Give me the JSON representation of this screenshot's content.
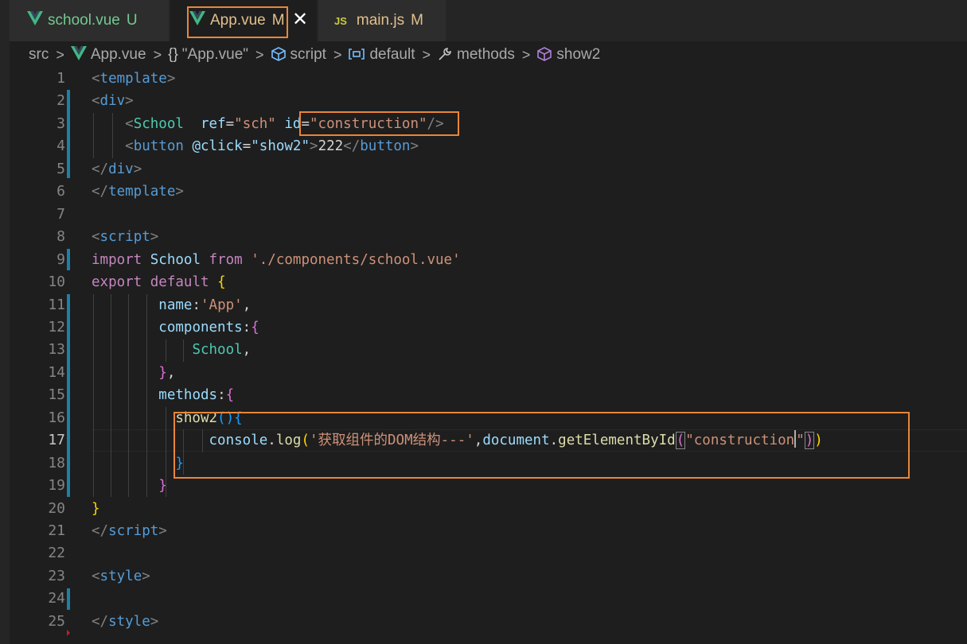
{
  "tabs": [
    {
      "label": "school.vue",
      "status": "U",
      "icon": "vue-icon",
      "label_color": "#73c991",
      "status_color": "#73c991"
    },
    {
      "label": "App.vue",
      "status": "M",
      "icon": "vue-icon",
      "label_color": "#e2c08d",
      "status_color": "#e2c08d",
      "active": true,
      "close": "✕"
    },
    {
      "label": "main.js",
      "status": "M",
      "icon": "js-icon",
      "icon_text": "JS",
      "label_color": "#e2c08d",
      "status_color": "#e2c08d"
    }
  ],
  "breadcrumb": {
    "items": [
      {
        "label": "src",
        "icon": ""
      },
      {
        "label": "App.vue",
        "icon": "vue-icon"
      },
      {
        "label": "\"App.vue\"",
        "icon": "braces-icon",
        "icon_text": "{}"
      },
      {
        "label": "script",
        "icon": "cube-icon"
      },
      {
        "label": "default",
        "icon": "variable-icon"
      },
      {
        "label": "methods",
        "icon": "wrench-icon"
      },
      {
        "label": "show2",
        "icon": "cube-icon"
      }
    ]
  },
  "editor": {
    "current_line": 17,
    "line_numbers": [
      "1",
      "2",
      "3",
      "4",
      "5",
      "6",
      "7",
      "8",
      "9",
      "10",
      "11",
      "12",
      "13",
      "14",
      "15",
      "16",
      "17",
      "18",
      "19",
      "20",
      "21",
      "22",
      "23",
      "24",
      "25"
    ],
    "lines": [
      [
        {
          "t": "<",
          "c": "c-punc"
        },
        {
          "t": "template",
          "c": "c-tag"
        },
        {
          "t": ">",
          "c": "c-punc"
        }
      ],
      [
        {
          "t": "<",
          "c": "c-punc"
        },
        {
          "t": "div",
          "c": "c-tag"
        },
        {
          "t": ">",
          "c": "c-punc"
        }
      ],
      [
        {
          "t": "    ",
          "c": "c-plain"
        },
        {
          "t": "<",
          "c": "c-punc"
        },
        {
          "t": "School",
          "c": "c-cls"
        },
        {
          "t": "  ",
          "c": "c-plain"
        },
        {
          "t": "ref",
          "c": "c-attr"
        },
        {
          "t": "=",
          "c": "c-plain"
        },
        {
          "t": "\"sch\"",
          "c": "c-str"
        },
        {
          "t": " ",
          "c": "c-plain"
        },
        {
          "t": "id",
          "c": "c-attr"
        },
        {
          "t": "=",
          "c": "c-plain"
        },
        {
          "t": "\"construction\"",
          "c": "c-str"
        },
        {
          "t": "/>",
          "c": "c-punc"
        }
      ],
      [
        {
          "t": "    ",
          "c": "c-plain"
        },
        {
          "t": "<",
          "c": "c-punc"
        },
        {
          "t": "button",
          "c": "c-tag"
        },
        {
          "t": " ",
          "c": "c-plain"
        },
        {
          "t": "@click",
          "c": "c-attr"
        },
        {
          "t": "=",
          "c": "c-plain"
        },
        {
          "t": "\"",
          "c": "c-attr"
        },
        {
          "t": "show2",
          "c": "c-var"
        },
        {
          "t": "\"",
          "c": "c-attr"
        },
        {
          "t": ">",
          "c": "c-punc"
        },
        {
          "t": "222",
          "c": "c-plain"
        },
        {
          "t": "</",
          "c": "c-punc"
        },
        {
          "t": "button",
          "c": "c-tag"
        },
        {
          "t": ">",
          "c": "c-punc"
        }
      ],
      [
        {
          "t": "</",
          "c": "c-punc"
        },
        {
          "t": "div",
          "c": "c-tag"
        },
        {
          "t": ">",
          "c": "c-punc"
        }
      ],
      [
        {
          "t": "</",
          "c": "c-punc"
        },
        {
          "t": "template",
          "c": "c-tag"
        },
        {
          "t": ">",
          "c": "c-punc"
        }
      ],
      [],
      [
        {
          "t": "<",
          "c": "c-punc"
        },
        {
          "t": "script",
          "c": "c-tag"
        },
        {
          "t": ">",
          "c": "c-punc"
        }
      ],
      [
        {
          "t": "import",
          "c": "c-kw"
        },
        {
          "t": " ",
          "c": "c-plain"
        },
        {
          "t": "School",
          "c": "c-var"
        },
        {
          "t": " ",
          "c": "c-plain"
        },
        {
          "t": "from",
          "c": "c-kw"
        },
        {
          "t": " ",
          "c": "c-plain"
        },
        {
          "t": "'./components/school.vue'",
          "c": "c-str"
        }
      ],
      [
        {
          "t": "export",
          "c": "c-kw"
        },
        {
          "t": " ",
          "c": "c-plain"
        },
        {
          "t": "default",
          "c": "c-kw"
        },
        {
          "t": " ",
          "c": "c-plain"
        },
        {
          "t": "{",
          "c": "c-yel"
        }
      ],
      [
        {
          "t": "        ",
          "c": "c-plain"
        },
        {
          "t": "name",
          "c": "c-var"
        },
        {
          "t": ":",
          "c": "c-plain"
        },
        {
          "t": "'App'",
          "c": "c-str"
        },
        {
          "t": ",",
          "c": "c-plain"
        }
      ],
      [
        {
          "t": "        ",
          "c": "c-plain"
        },
        {
          "t": "components",
          "c": "c-var"
        },
        {
          "t": ":",
          "c": "c-plain"
        },
        {
          "t": "{",
          "c": "c-pink"
        }
      ],
      [
        {
          "t": "            ",
          "c": "c-plain"
        },
        {
          "t": "School",
          "c": "c-cls"
        },
        {
          "t": ",",
          "c": "c-plain"
        }
      ],
      [
        {
          "t": "        ",
          "c": "c-plain"
        },
        {
          "t": "}",
          "c": "c-pink"
        },
        {
          "t": ",",
          "c": "c-plain"
        }
      ],
      [
        {
          "t": "        ",
          "c": "c-plain"
        },
        {
          "t": "methods",
          "c": "c-var"
        },
        {
          "t": ":",
          "c": "c-plain"
        },
        {
          "t": "{",
          "c": "c-pink"
        }
      ],
      [
        {
          "t": "          ",
          "c": "c-plain"
        },
        {
          "t": "show2",
          "c": "c-fn"
        },
        {
          "t": "()",
          "c": "c-blue2"
        },
        {
          "t": "{",
          "c": "c-blue2"
        }
      ],
      [
        {
          "t": "              ",
          "c": "c-plain"
        },
        {
          "t": "console",
          "c": "c-var"
        },
        {
          "t": ".",
          "c": "c-plain"
        },
        {
          "t": "log",
          "c": "c-fn"
        },
        {
          "t": "(",
          "c": "c-yel"
        },
        {
          "t": "'获取组件的DOM结构---'",
          "c": "c-str"
        },
        {
          "t": ",",
          "c": "c-plain"
        },
        {
          "t": "document",
          "c": "c-var"
        },
        {
          "t": ".",
          "c": "c-plain"
        },
        {
          "t": "getElementById",
          "c": "c-fn"
        },
        {
          "t": "(",
          "c": "c-pink",
          "box": true
        },
        {
          "t": "\"construction",
          "c": "c-str"
        },
        {
          "t": "CURSOR",
          "c": "cursor"
        },
        {
          "t": "\"",
          "c": "c-str"
        },
        {
          "t": ")",
          "c": "c-pink",
          "box": true
        },
        {
          "t": ")",
          "c": "c-yel"
        }
      ],
      [
        {
          "t": "          ",
          "c": "c-plain"
        },
        {
          "t": "}",
          "c": "c-blue2"
        }
      ],
      [
        {
          "t": "        ",
          "c": "c-plain"
        },
        {
          "t": "}",
          "c": "c-pink"
        }
      ],
      [
        {
          "t": "}",
          "c": "c-yel"
        }
      ],
      [
        {
          "t": "</",
          "c": "c-punc"
        },
        {
          "t": "script",
          "c": "c-tag"
        },
        {
          "t": ">",
          "c": "c-punc"
        }
      ],
      [],
      [
        {
          "t": "<",
          "c": "c-punc"
        },
        {
          "t": "style",
          "c": "c-tag"
        },
        {
          "t": ">",
          "c": "c-punc"
        }
      ],
      [],
      [
        {
          "t": "</",
          "c": "c-punc"
        },
        {
          "t": "style",
          "c": "c-tag"
        },
        {
          "t": ">",
          "c": "c-punc"
        }
      ]
    ]
  },
  "colors": {
    "highlight": "#e8863a",
    "vue_green": "#41b883",
    "vue_dark": "#35495e",
    "accent": "#1b81a8"
  }
}
